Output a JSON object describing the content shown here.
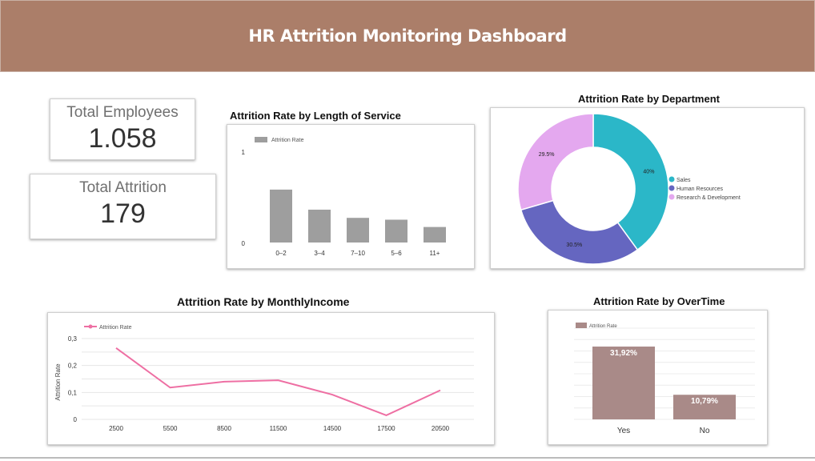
{
  "dashboard": {
    "title": "HR Attrition Monitoring Dashboard"
  },
  "kpis": {
    "total_employees": {
      "label": "Total Employees",
      "value": "1.058"
    },
    "total_attrition": {
      "label": "Total Attrition",
      "value": "179"
    }
  },
  "colors": {
    "header": "#ab7e69",
    "bar_gray": "#9e9e9e",
    "sales": "#2bb7c8",
    "hr": "#6566c0",
    "rnd": "#e4a8ef",
    "line_pink": "#ee6fa3",
    "overtime_bar": "#a98a88"
  },
  "chart_data": [
    {
      "id": "length_of_service",
      "type": "bar",
      "title": "Attrition Rate by Length of Service",
      "legend": "Attrition Rate",
      "categories": [
        "0–2",
        "3–4",
        "7–10",
        "5–6",
        "11+"
      ],
      "values": [
        0.58,
        0.36,
        0.27,
        0.25,
        0.17
      ],
      "ylim": [
        0,
        1
      ],
      "yticks": [
        "0",
        "1"
      ],
      "legend_position": "top-left",
      "grid": false
    },
    {
      "id": "department",
      "type": "pie",
      "title": "Attrition Rate by Department",
      "labels": [
        "Sales",
        "Human Resources",
        "Research & Development"
      ],
      "values": [
        40,
        30.5,
        29.5
      ],
      "value_labels": [
        "40%",
        "30.5%",
        "29.5%"
      ],
      "colors": [
        "#2bb7c8",
        "#6566c0",
        "#e4a8ef"
      ],
      "donut": true,
      "legend_position": "right"
    },
    {
      "id": "monthly_income",
      "type": "line",
      "title": "Attrition Rate by MonthlyIncome",
      "legend": "Attrition Rate",
      "ylabel": "Attrition Rate",
      "x": [
        "2500",
        "5500",
        "8500",
        "11500",
        "14500",
        "17500",
        "20500"
      ],
      "values": [
        0.265,
        0.118,
        0.14,
        0.145,
        0.092,
        0.015,
        0.108
      ],
      "ylim": [
        0,
        0.3
      ],
      "yticks": [
        "0",
        "0,1",
        "0,2",
        "0,3"
      ],
      "legend_position": "top-left",
      "grid": true
    },
    {
      "id": "overtime",
      "type": "bar",
      "title": "Attrition Rate by OverTime",
      "legend": "Attrition Rate",
      "categories": [
        "Yes",
        "No"
      ],
      "values": [
        31.92,
        10.79
      ],
      "value_labels": [
        "31,92%",
        "10,79%"
      ],
      "ylim": [
        0,
        40
      ],
      "legend_position": "top-left",
      "grid": true
    }
  ]
}
